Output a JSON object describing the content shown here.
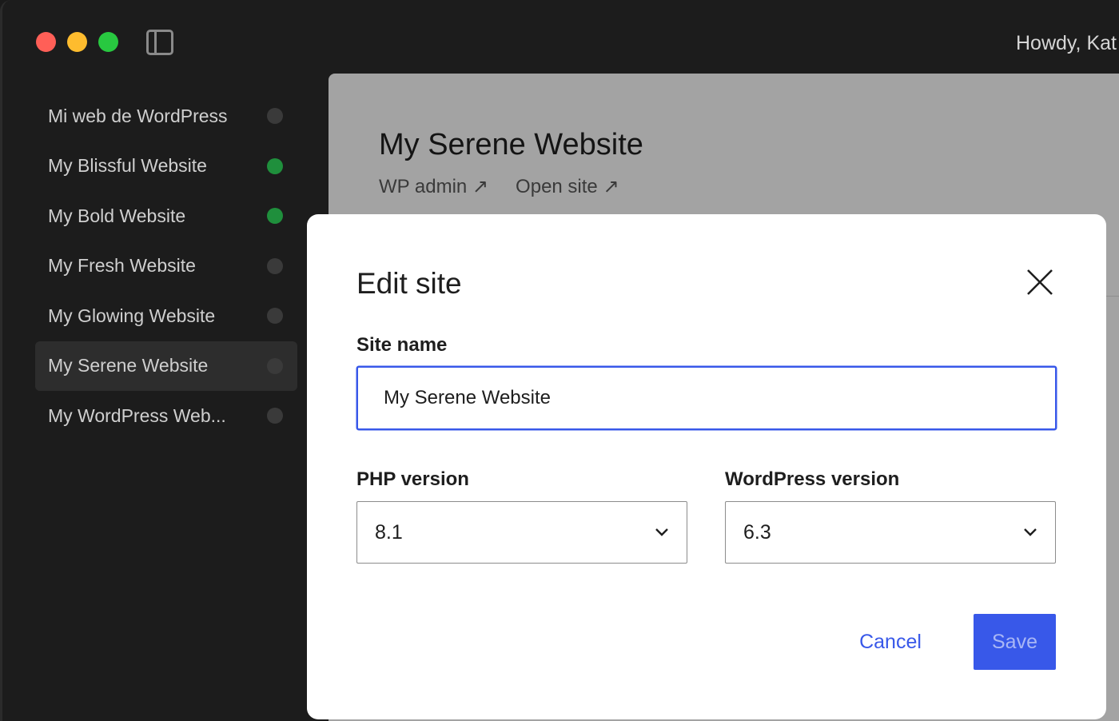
{
  "header": {
    "greeting": "Howdy, Kat"
  },
  "sidebar": {
    "sites": [
      {
        "name": "Mi web de WordPress",
        "status": "stopped"
      },
      {
        "name": "My Blissful Website",
        "status": "running"
      },
      {
        "name": "My Bold Website",
        "status": "running"
      },
      {
        "name": "My Fresh Website",
        "status": "stopped"
      },
      {
        "name": "My Glowing Website",
        "status": "stopped"
      },
      {
        "name": "My Serene Website",
        "status": "stopped",
        "selected": true
      },
      {
        "name": "My WordPress Web...",
        "status": "stopped"
      }
    ]
  },
  "main": {
    "site_title": "My Serene Website",
    "wp_admin_link": "WP admin ↗",
    "open_site_link": "Open site ↗"
  },
  "modal": {
    "title": "Edit site",
    "site_name_label": "Site name",
    "site_name_value": "My Serene Website",
    "php_label": "PHP version",
    "php_value": "8.1",
    "wp_label": "WordPress version",
    "wp_value": "6.3",
    "cancel_label": "Cancel",
    "save_label": "Save"
  },
  "colors": {
    "accent": "#3858e9",
    "running": "#1f8f3c",
    "stopped": "#3a3a3a"
  }
}
